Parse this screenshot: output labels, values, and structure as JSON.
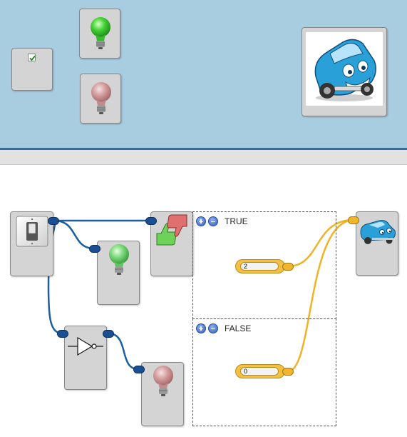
{
  "preview": {
    "checkbox": {
      "checked": true
    },
    "bulb_on": {
      "color": "#49d63a"
    },
    "bulb_off": {
      "color": "#d49c9c"
    },
    "truck_image": {
      "icon": "cartoon-blue-truck"
    }
  },
  "canvas": {
    "nodes": {
      "switch": {
        "icon": "toggle-switch-icon"
      },
      "bulb_green": {
        "color": "#7ad67a"
      },
      "thumbs": {
        "icon": "thumbs-up-down-icon"
      },
      "not_gate": {
        "icon": "not-gate-icon"
      },
      "bulb_red": {
        "color": "#d49c9c"
      },
      "truck": {
        "icon": "cartoon-blue-truck"
      }
    },
    "condition": {
      "true_branch": {
        "label": "TRUE",
        "value": "2"
      },
      "false_branch": {
        "label": "FALSE",
        "value": "0"
      }
    },
    "colors": {
      "wire_blue": "#1b5fa0",
      "wire_gold": "#efb326"
    }
  }
}
